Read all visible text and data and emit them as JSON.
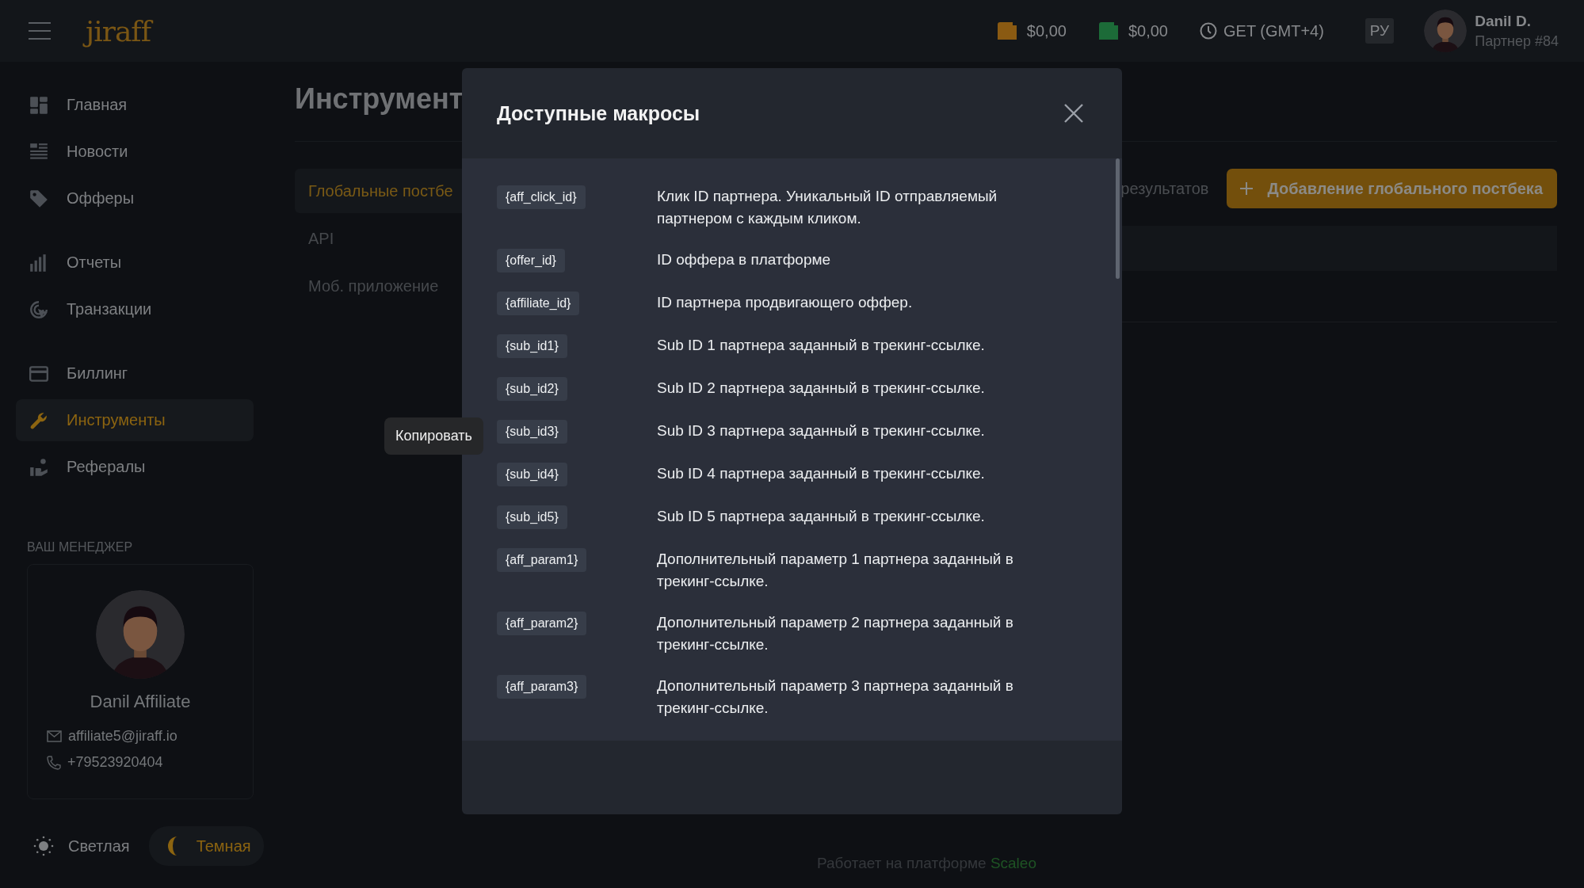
{
  "header": {
    "logo": "jiraff",
    "balances": [
      {
        "amount": "$0,00",
        "color": "#8a5a12"
      },
      {
        "amount": "$0,00",
        "color": "#1c6b38"
      }
    ],
    "timezone": "GET (GMT+4)",
    "language": "РУ",
    "user": {
      "name": "Danil D.",
      "role": "Партнер #84"
    }
  },
  "sidebar": {
    "groups": [
      [
        {
          "label": "Главная",
          "kind": "home",
          "selected": false
        },
        {
          "label": "Новости",
          "kind": "news",
          "selected": false
        },
        {
          "label": "Офферы",
          "kind": "offers",
          "selected": false
        }
      ],
      [
        {
          "label": "Отчеты",
          "kind": "reports",
          "selected": false
        },
        {
          "label": "Транзакции",
          "kind": "transactions",
          "selected": false
        }
      ],
      [
        {
          "label": "Биллинг",
          "kind": "billing",
          "selected": false
        },
        {
          "label": "Инструменты",
          "kind": "tools",
          "selected": true
        },
        {
          "label": "Рефералы",
          "kind": "referrals",
          "selected": false
        }
      ]
    ]
  },
  "manager": {
    "heading": "ВАШ МЕНЕДЖЕР",
    "name": "Danil Affiliate",
    "email": "affiliate5@jiraff.io",
    "phone": "+79523920404"
  },
  "theme_switch": [
    {
      "label": "Светлая",
      "kind": "light",
      "selected": false
    },
    {
      "label": "Темная",
      "kind": "dark",
      "selected": true
    }
  ],
  "page": {
    "title": "Инструмент",
    "tabs": [
      {
        "label": "Глобальные постбе",
        "selected": true
      },
      {
        "label": "API",
        "selected": false
      },
      {
        "label": "Моб. приложение",
        "selected": false
      }
    ],
    "results_text": "результатов",
    "add_button": "Добавление глобального постбека"
  },
  "tooltip": "Копировать",
  "modal": {
    "title": "Доступные макросы",
    "macros": [
      {
        "tag": "{aff_click_id}",
        "description": "Клик ID партнера. Уникальный ID отправляемый партнером с каждым кликом."
      },
      {
        "tag": "{offer_id}",
        "description": "ID оффера в платформе"
      },
      {
        "tag": "{affiliate_id}",
        "description": "ID партнера продвигающего оффер."
      },
      {
        "tag": "{sub_id1}",
        "description": "Sub ID 1 партнера заданный в трекинг-ссылке."
      },
      {
        "tag": "{sub_id2}",
        "description": "Sub ID 2 партнера заданный в трекинг-ссылке."
      },
      {
        "tag": "{sub_id3}",
        "description": "Sub ID 3 партнера заданный в трекинг-ссылке."
      },
      {
        "tag": "{sub_id4}",
        "description": "Sub ID 4 партнера заданный в трекинг-ссылке."
      },
      {
        "tag": "{sub_id5}",
        "description": "Sub ID 5 партнера заданный в трекинг-ссылке."
      },
      {
        "tag": "{aff_param1}",
        "description": "Дополнительный параметр 1 партнера заданный в трекинг-ссылке."
      },
      {
        "tag": "{aff_param2}",
        "description": "Дополнительный параметр 2 партнера заданный в трекинг-ссылке."
      },
      {
        "tag": "{aff_param3}",
        "description": "Дополнительный параметр 3 партнера заданный в трекинг-ссылке."
      }
    ]
  },
  "footer": {
    "text": "Работает на платформе",
    "link": "Scaleo"
  }
}
